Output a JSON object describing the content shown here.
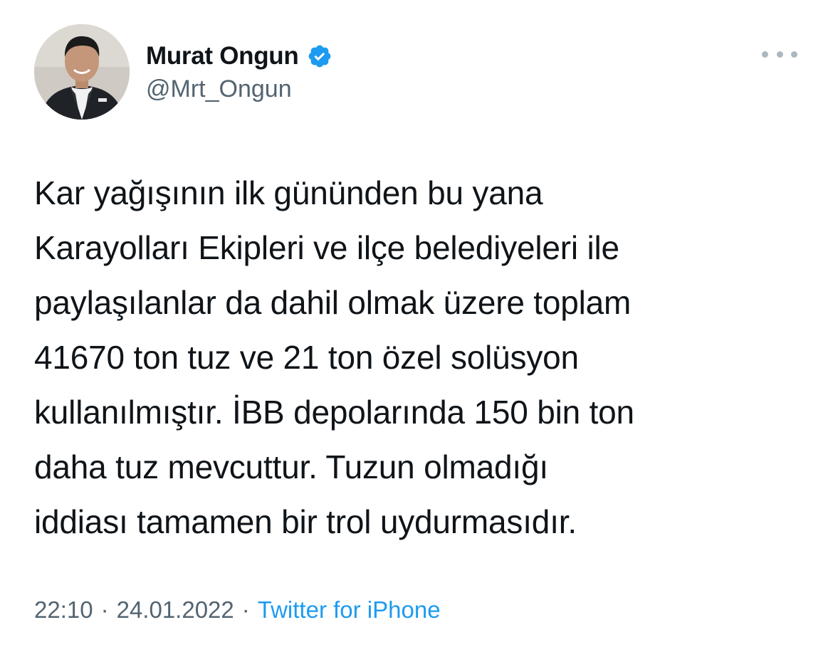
{
  "author": {
    "display_name": "Murat Ongun",
    "handle": "@Mrt_Ongun",
    "verified": true,
    "avatar_icon": "profile-photo"
  },
  "actions": {
    "more_icon": "more-horizontal-icon"
  },
  "tweet": {
    "lines": [
      "Kar yağışının ilk gününden bu yana",
      "Karayolları Ekipleri ve ilçe belediyeleri ile",
      "paylaşılanlar da dahil olmak üzere toplam",
      "41670 ton tuz ve 21 ton özel solüsyon",
      "kullanılmıştır. İBB depolarında 150 bin ton",
      "daha tuz mevcuttur. Tuzun olmadığı",
      "iddiası tamamen bir trol uydurmasıdır."
    ]
  },
  "meta": {
    "time": "22:10",
    "separator": "·",
    "date": "24.01.2022",
    "source": "Twitter for iPhone"
  },
  "colors": {
    "text": "#0f1419",
    "secondary": "#536471",
    "link": "#1d9bf0",
    "verified_badge": "#1d9bf0"
  }
}
